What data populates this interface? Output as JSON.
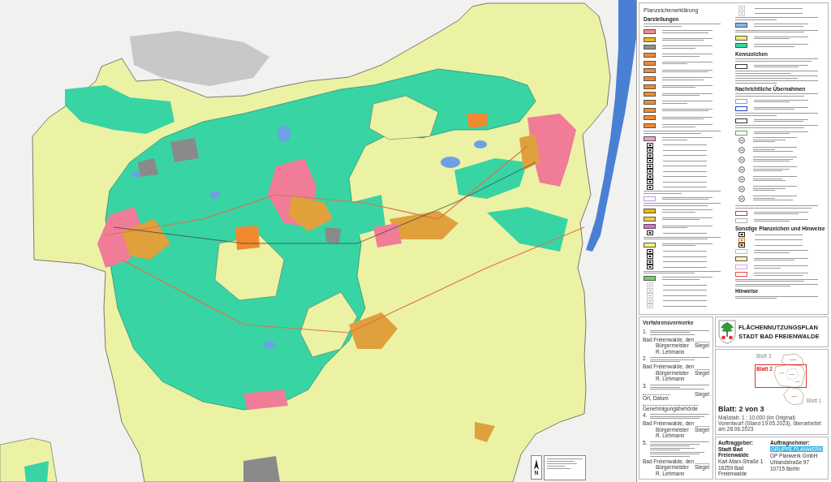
{
  "map": {
    "north_label": "N"
  },
  "legend": {
    "columns": [
      {
        "items": [
          {
            "kind": "title",
            "text": "Planzeichenerklärung"
          },
          {
            "kind": "heading",
            "text": "Darstellungen"
          },
          {
            "kind": "note"
          },
          {
            "kind": "fill",
            "color": "#f08c8c"
          },
          {
            "kind": "fill",
            "color": "#e8b42c"
          },
          {
            "kind": "fill",
            "color": "#8f8f8f"
          },
          {
            "kind": "fill",
            "color": "#f28a2e"
          },
          {
            "kind": "fill",
            "color": "#f28a2e"
          },
          {
            "kind": "fill",
            "color": "#f28a2e"
          },
          {
            "kind": "fill",
            "color": "#f28a2e"
          },
          {
            "kind": "fill",
            "color": "#f28a2e"
          },
          {
            "kind": "fill",
            "color": "#f28a2e"
          },
          {
            "kind": "fill",
            "color": "#f28a2e"
          },
          {
            "kind": "fill",
            "color": "#f28a2e"
          },
          {
            "kind": "fill",
            "color": "#f28a2e"
          },
          {
            "kind": "fill",
            "color": "#f28a2e"
          },
          {
            "kind": "note"
          },
          {
            "kind": "fill",
            "color": "#f59bd2"
          },
          {
            "kind": "symbol",
            "color": "#222222"
          },
          {
            "kind": "symbol",
            "color": "#222222"
          },
          {
            "kind": "symbol",
            "color": "#222222"
          },
          {
            "kind": "symbol",
            "color": "#222222"
          },
          {
            "kind": "symbol",
            "color": "#222222"
          },
          {
            "kind": "symbol",
            "color": "#222222"
          },
          {
            "kind": "symbol",
            "color": "#222222"
          },
          {
            "kind": "symbol",
            "color": "#222222"
          },
          {
            "kind": "symbol",
            "color": "#222222"
          },
          {
            "kind": "note"
          },
          {
            "kind": "outline",
            "color": "#b89ae0"
          },
          {
            "kind": "note"
          },
          {
            "kind": "fill",
            "color": "#f5b800"
          },
          {
            "kind": "fill",
            "color": "#f8c94a"
          },
          {
            "kind": "fill",
            "color": "#e067e0"
          },
          {
            "kind": "symbol",
            "color": "#222222"
          },
          {
            "kind": "note"
          },
          {
            "kind": "fill",
            "color": "#f6f27a"
          },
          {
            "kind": "symbol",
            "color": "#222222"
          },
          {
            "kind": "symbol",
            "color": "#222222"
          },
          {
            "kind": "symbol",
            "color": "#222222"
          },
          {
            "kind": "symbol",
            "color": "#222222"
          },
          {
            "kind": "note"
          },
          {
            "kind": "fill",
            "color": "#76d160"
          },
          {
            "kind": "symbol",
            "color": "#c8c8c8"
          },
          {
            "kind": "symbol",
            "color": "#c8c8c8"
          },
          {
            "kind": "symbol",
            "color": "#c8c8c8"
          },
          {
            "kind": "symbol",
            "color": "#c8c8c8"
          },
          {
            "kind": "symbol",
            "color": "#c8c8c8"
          }
        ]
      },
      {
        "items": [
          {
            "kind": "symbol",
            "color": "#c8c8c8"
          },
          {
            "kind": "symbol",
            "color": "#c8c8c8"
          },
          {
            "kind": "note"
          },
          {
            "kind": "fill",
            "color": "#7db8ee"
          },
          {
            "kind": "note"
          },
          {
            "kind": "fill",
            "color": "#e6f56e"
          },
          {
            "kind": "fill",
            "color": "#2fd8a4"
          },
          {
            "kind": "heading",
            "text": "Kennzeichen"
          },
          {
            "kind": "note"
          },
          {
            "kind": "outline",
            "color": "#333333"
          },
          {
            "kind": "note"
          },
          {
            "kind": "note"
          },
          {
            "kind": "note"
          },
          {
            "kind": "heading",
            "text": "Nachrichtliche Übernahmen"
          },
          {
            "kind": "note"
          },
          {
            "kind": "outline",
            "color": "#9a96f0"
          },
          {
            "kind": "outline",
            "color": "#2446c8"
          },
          {
            "kind": "note"
          },
          {
            "kind": "outline",
            "color": "#333333"
          },
          {
            "kind": "note"
          },
          {
            "kind": "outline",
            "color": "#58a858"
          },
          {
            "kind": "circle"
          },
          {
            "kind": "circle"
          },
          {
            "kind": "circle"
          },
          {
            "kind": "circle"
          },
          {
            "kind": "circle"
          },
          {
            "kind": "circle"
          },
          {
            "kind": "circle"
          },
          {
            "kind": "note"
          },
          {
            "kind": "outline",
            "color": "#e03030"
          },
          {
            "kind": "outline",
            "color": "#aaaaaa"
          },
          {
            "kind": "heading",
            "text": "Sonstige Planzeichen und Hinweise"
          },
          {
            "kind": "symbol",
            "color": "#222222"
          },
          {
            "kind": "symbol",
            "color": "#c8893a"
          },
          {
            "kind": "symbol",
            "color": "#222222"
          },
          {
            "kind": "outline",
            "color": "#bbbbbb"
          },
          {
            "kind": "fill",
            "color": "#faf5b0"
          },
          {
            "kind": "outline",
            "color": "#d8a0e0"
          },
          {
            "kind": "outline",
            "color": "#e84848"
          },
          {
            "kind": "note"
          },
          {
            "kind": "note"
          },
          {
            "kind": "subheading",
            "text": "Hinweise"
          },
          {
            "kind": "note"
          }
        ]
      }
    ]
  },
  "procedure_notes": {
    "title": "Verfahrensvermerke",
    "entries": [
      {
        "number": "1.",
        "kind": "short",
        "signature": {
          "kind": "mayor",
          "place": "Bad Freienwalde, den",
          "role": "Bürgermeister",
          "name": "R. Lehmann",
          "seal": "Siegel"
        }
      },
      {
        "number": "2.",
        "kind": "short",
        "signature": {
          "kind": "mayor",
          "place": "Bad Freienwalde, den",
          "role": "Bürgermeister",
          "name": "R. Lehmann",
          "seal": "Siegel"
        }
      },
      {
        "number": "3.",
        "kind": "short",
        "signature": {
          "kind": "authority",
          "place": "Ort, Datum",
          "role": "Genehmigungsbehörde",
          "seal": "Siegel"
        }
      },
      {
        "number": "4.",
        "kind": "short",
        "signature": {
          "kind": "mayor",
          "place": "Bad Freienwalde, den",
          "role": "Bürgermeister",
          "name": "R. Lehmann",
          "seal": "Siegel"
        }
      },
      {
        "number": "5.",
        "kind": "long",
        "signature": {
          "kind": "mayor",
          "place": "Bad Freienwalde, den",
          "role": "Bürgermeister",
          "name": "R. Lehmann",
          "seal": "Siegel"
        }
      }
    ]
  },
  "title_block": {
    "title_lines": [
      "FLÄCHENNUTZUNGSPLAN",
      "STADT BAD FREIENWALDE"
    ],
    "overview": {
      "sheets": [
        {
          "label": "Blatt 3",
          "selected": false
        },
        {
          "label": "Blatt 2",
          "selected": true
        },
        {
          "label": "Blatt 1",
          "selected": false
        }
      ]
    },
    "sheet": "Blatt: 2 von 3",
    "scale": "Maßstab: 1 : 10.000 (im Original)",
    "status": "Vorentwurf (Stand 19.05.2023), überarbeitet am 28.06.2023",
    "client": {
      "heading": "Auftraggeber:",
      "name": "Stadt Bad Freienwalde",
      "lines": [
        "Karl-Marx-Straße 1",
        "16259 Bad Freienwalde"
      ]
    },
    "contractor": {
      "heading": "Auftragnehmer:",
      "logo": "GRUPPE PLANWERK",
      "lines": [
        "GP Planwerk GmbH",
        "Uhlandstraße 97",
        "10715 Berlin"
      ]
    }
  }
}
